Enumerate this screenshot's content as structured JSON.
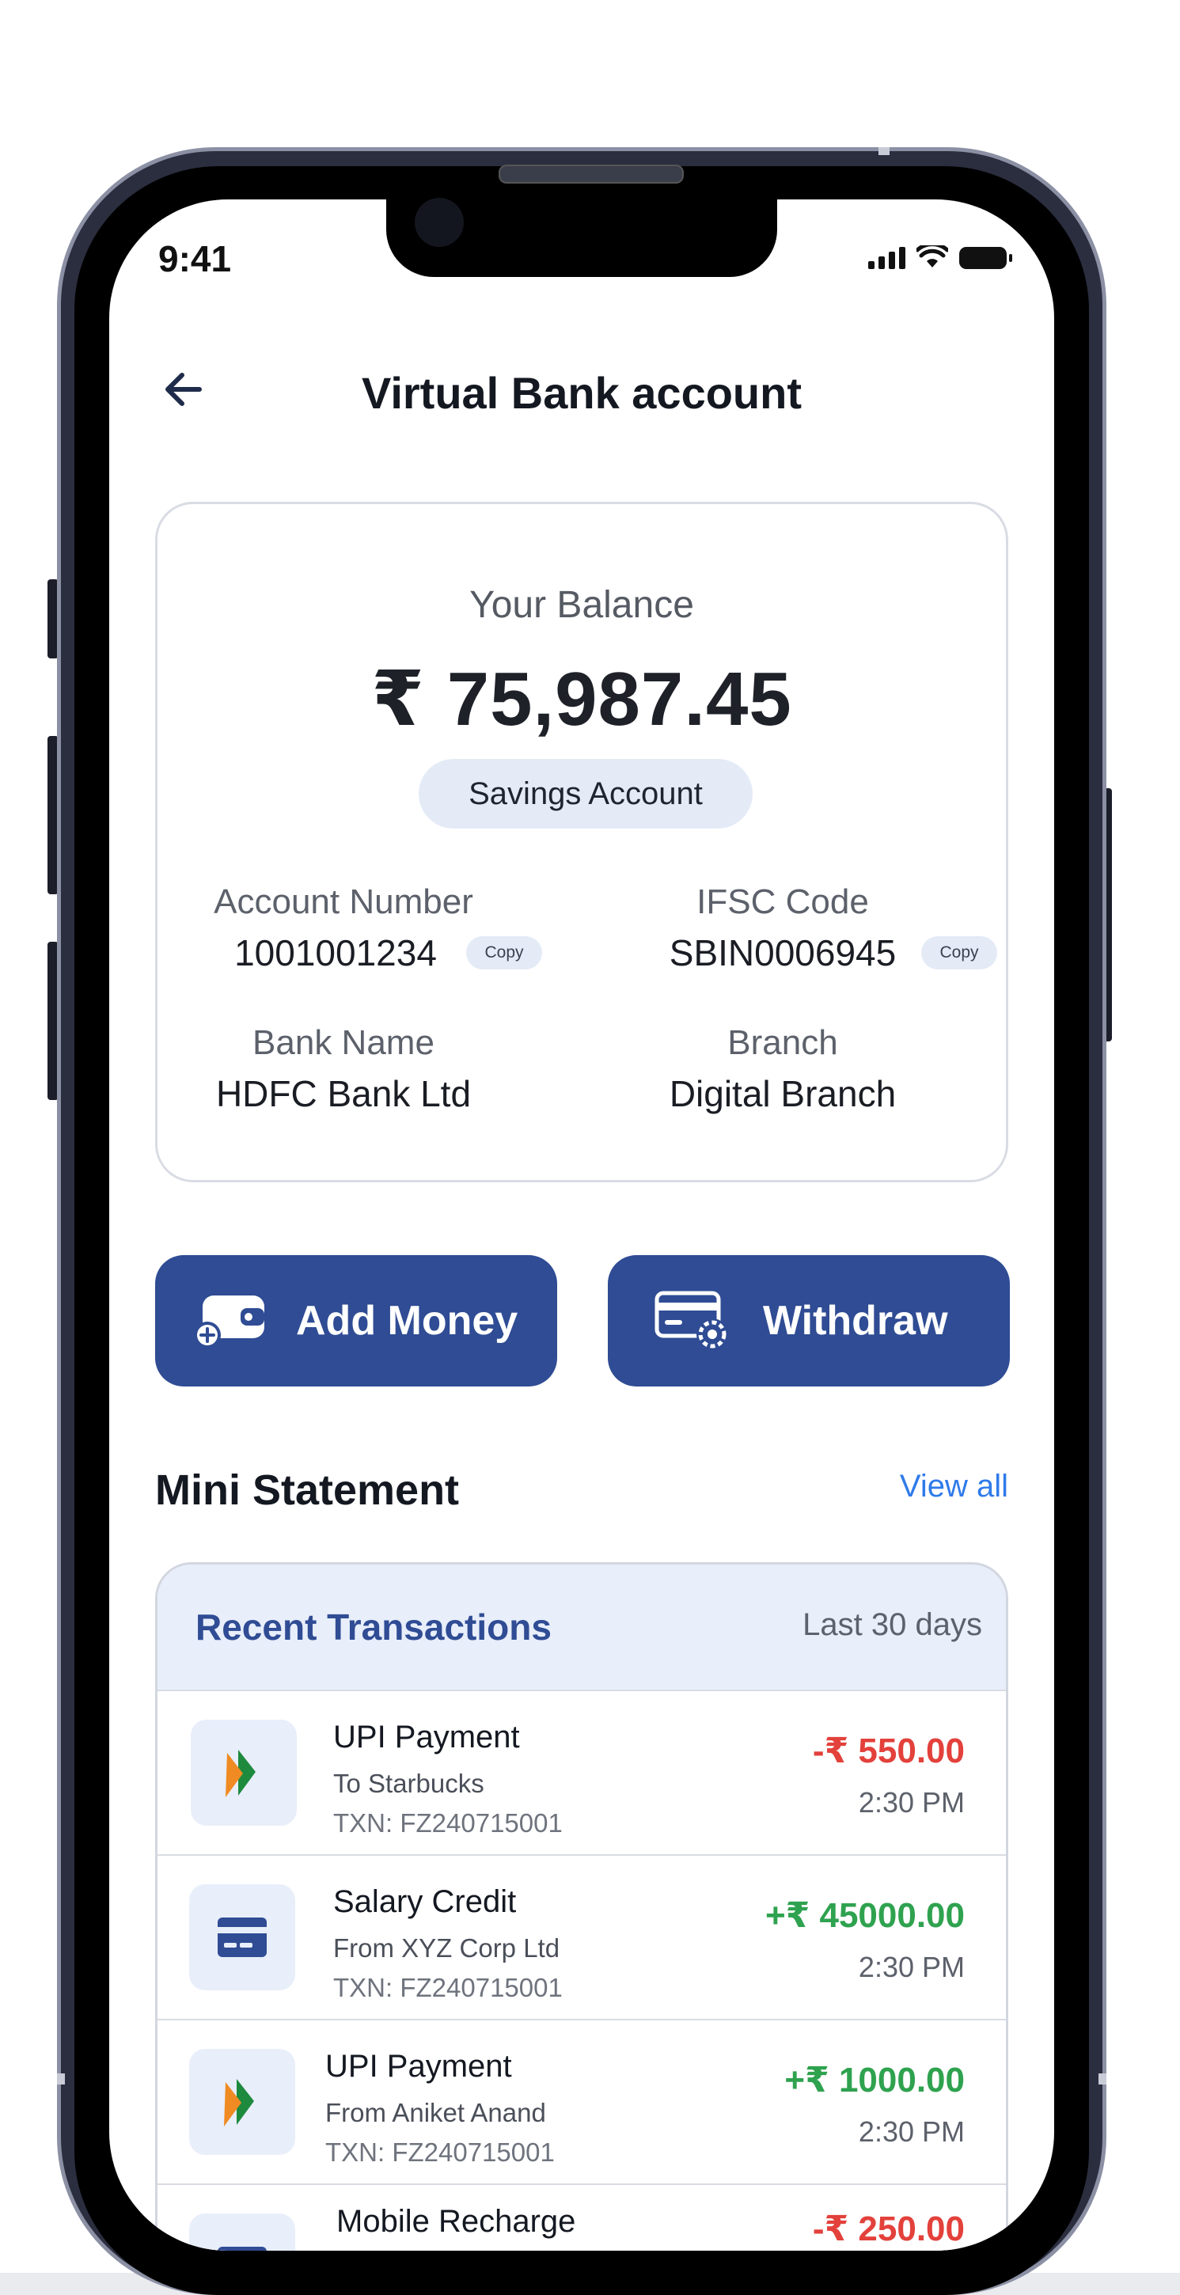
{
  "status_bar": {
    "time": "9:41"
  },
  "header": {
    "title": "Virtual Bank account"
  },
  "balance": {
    "label": "Your Balance",
    "amount": "₹ 75,987.45",
    "account_type": "Savings Account",
    "account_number_label": "Account Number",
    "account_number": "1001001234",
    "ifsc_label": "IFSC Code",
    "ifsc": "SBIN0006945",
    "copy_label": "Copy",
    "bank_name_label": "Bank Name",
    "bank_name": "HDFC Bank Ltd",
    "branch_label": "Branch",
    "branch": "Digital Branch"
  },
  "actions": {
    "add_money": "Add Money",
    "withdraw": "Withdraw"
  },
  "mini_statement": {
    "title": "Mini Statement",
    "view_all": "View all",
    "panel_title": "Recent Transactions",
    "range": "Last 30 days",
    "transactions": [
      {
        "icon": "upi-icon",
        "title": "UPI Payment",
        "sub": "To Starbucks",
        "ref": "TXN: FZ240715001",
        "amount": "-₹ 550.00",
        "time": "2:30 PM",
        "direction": "debit"
      },
      {
        "icon": "card-icon",
        "title": "Salary Credit",
        "sub": "From XYZ Corp Ltd",
        "ref": "TXN: FZ240715001",
        "amount": "+₹ 45000.00",
        "time": "2:30 PM",
        "direction": "credit"
      },
      {
        "icon": "upi-icon",
        "title": "UPI Payment",
        "sub": "From Aniket Anand",
        "ref": "TXN: FZ240715001",
        "amount": "+₹ 1000.00",
        "time": "2:30 PM",
        "direction": "credit"
      },
      {
        "icon": "card-icon",
        "title": "Mobile Recharge",
        "sub": "",
        "ref": "",
        "amount": "-₹ 250.00",
        "time": "",
        "direction": "debit"
      }
    ]
  },
  "colors": {
    "primary": "#2f4c94",
    "pill": "#e4ebf7",
    "debit": "#e3413b",
    "credit": "#2fa24f",
    "link": "#2f7bea"
  }
}
